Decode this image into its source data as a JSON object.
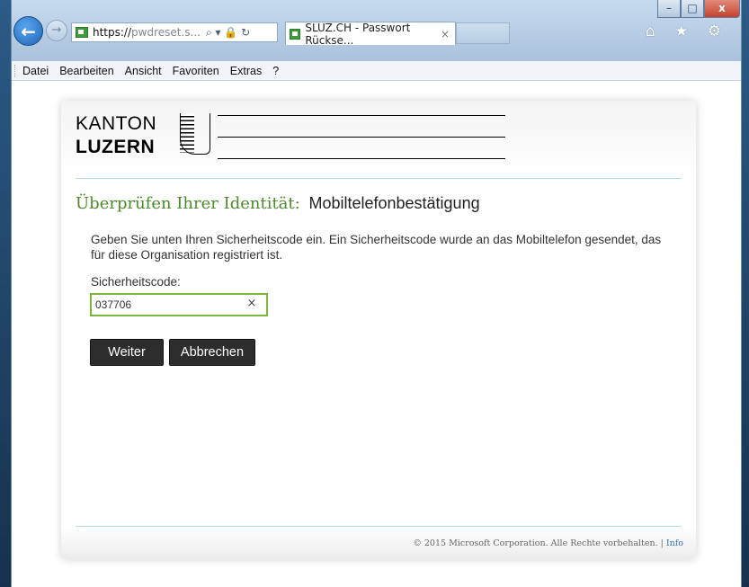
{
  "window": {
    "controls": {
      "minimize": "–",
      "maximize": "□",
      "close": "x"
    }
  },
  "browser": {
    "back_icon": "←",
    "forward_icon": "→",
    "address": {
      "strong": "https://",
      "gray": "pwdreset.s...",
      "icons": "⌕ ▾ 🔒 ↻"
    },
    "tab": {
      "title": "SLUZ.CH - Passwort Rückse...",
      "close": "×"
    },
    "tools_icons": "⌂ ★ ⚙"
  },
  "menu": {
    "items": [
      "Datei",
      "Bearbeiten",
      "Ansicht",
      "Favoriten",
      "Extras",
      "?"
    ]
  },
  "logo": {
    "line1": "KANTON",
    "line2": "LUZERN"
  },
  "page": {
    "title_main": "Überprüfen Ihrer Identität:",
    "title_sub": "Mobiltelefonbestätigung",
    "description": "Geben Sie unten Ihren Sicherheitscode ein. Ein Sicherheitscode wurde an das Mobiltelefon gesendet, das für diese Organisation registriert ist.",
    "code_label": "Sicherheitscode:",
    "code_value": "037706",
    "clear_icon": "×",
    "continue_label": "Weiter",
    "cancel_label": "Abbrechen"
  },
  "footer": {
    "copyright": "© 2015 Microsoft Corporation. Alle Rechte vorbehalten.",
    "separator": "|",
    "info_link": "Info"
  },
  "colors": {
    "title_green": "#4c8a2a",
    "input_border": "#7ab83c",
    "button_bg": "#2d2d2d",
    "link_blue": "#2f6fb6"
  }
}
